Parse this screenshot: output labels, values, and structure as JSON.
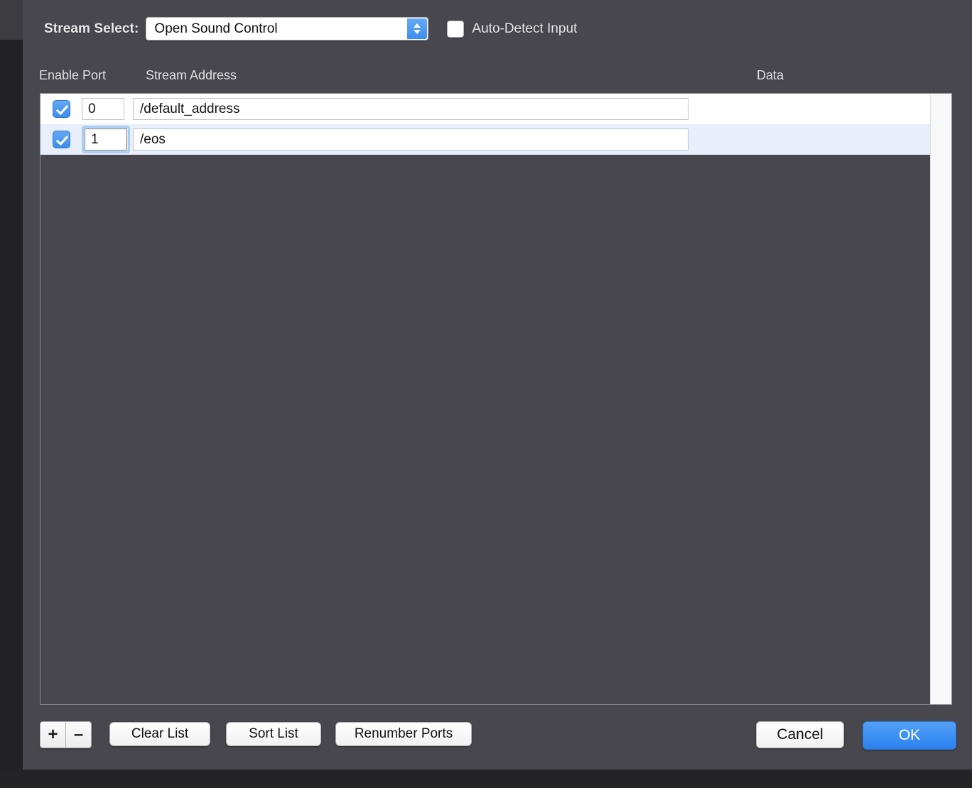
{
  "dialog": {
    "stream_select_label": "Stream Select:",
    "stream_select_value": "Open Sound Control",
    "auto_detect_label": "Auto-Detect Input"
  },
  "table": {
    "headers": {
      "enable_port": "Enable Port",
      "stream_address": "Stream Address",
      "data": "Data"
    },
    "rows": [
      {
        "enabled": true,
        "port": "0",
        "address": "/default_address",
        "data": ""
      },
      {
        "enabled": true,
        "port": "1",
        "address": "/eos",
        "data": ""
      }
    ]
  },
  "buttons": {
    "add": "+",
    "remove": "–",
    "clear_list": "Clear List",
    "sort_list": "Sort List",
    "renumber_ports": "Renumber Ports",
    "cancel": "Cancel",
    "ok": "OK"
  },
  "colors": {
    "panel_bg": "#47474d",
    "accent_blue": "#3d8ef0",
    "row_selected": "#e8effb",
    "row_normal": "#ffffff"
  }
}
